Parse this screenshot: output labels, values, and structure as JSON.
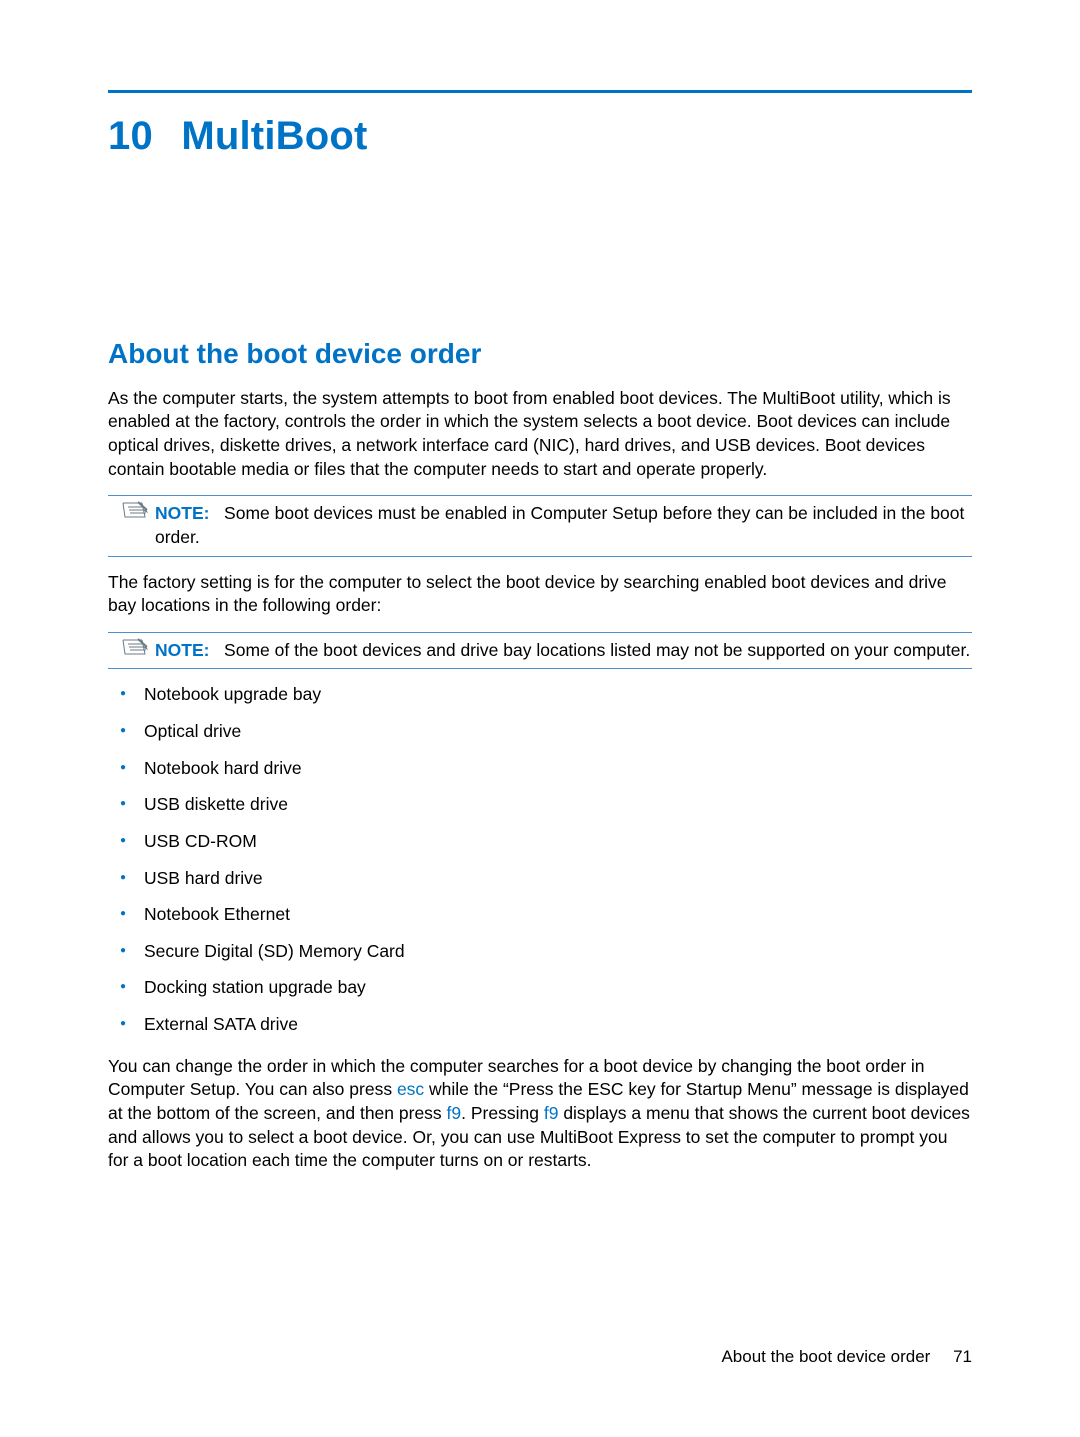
{
  "chapter": {
    "number": "10",
    "title": "MultiBoot"
  },
  "section": {
    "title": "About the boot device order"
  },
  "paragraphs": {
    "intro": "As the computer starts, the system attempts to boot from enabled boot devices. The MultiBoot utility, which is enabled at the factory, controls the order in which the system selects a boot device. Boot devices can include optical drives, diskette drives, a network interface card (NIC), hard drives, and USB devices. Boot devices contain bootable media or files that the computer needs to start and operate properly.",
    "factory": "The factory setting is for the computer to select the boot device by searching enabled boot devices and drive bay locations in the following order:",
    "change_pre": "You can change the order in which the computer searches for a boot device by changing the boot order in Computer Setup. You can also press ",
    "change_mid1": " while the “Press the ESC key for Startup Menu” message is displayed at the bottom of the screen, and then press ",
    "change_mid2": ". Pressing ",
    "change_post": " displays a menu that shows the current boot devices and allows you to select a boot device. Or, you can use MultiBoot Express to set the computer to prompt you for a boot location each time the computer turns on or restarts."
  },
  "keys": {
    "esc": "esc",
    "f9a": "f9",
    "f9b": "f9"
  },
  "notes": {
    "label": "NOTE:",
    "note1": "Some boot devices must be enabled in Computer Setup before they can be included in the boot order.",
    "note2": "Some of the boot devices and drive bay locations listed may not be supported on your computer."
  },
  "list": [
    "Notebook upgrade bay",
    "Optical drive",
    "Notebook hard drive",
    "USB diskette drive",
    "USB CD-ROM",
    "USB hard drive",
    "Notebook Ethernet",
    "Secure Digital (SD) Memory Card",
    "Docking station upgrade bay",
    "External SATA drive"
  ],
  "footer": {
    "title": "About the boot device order",
    "page": "71"
  }
}
